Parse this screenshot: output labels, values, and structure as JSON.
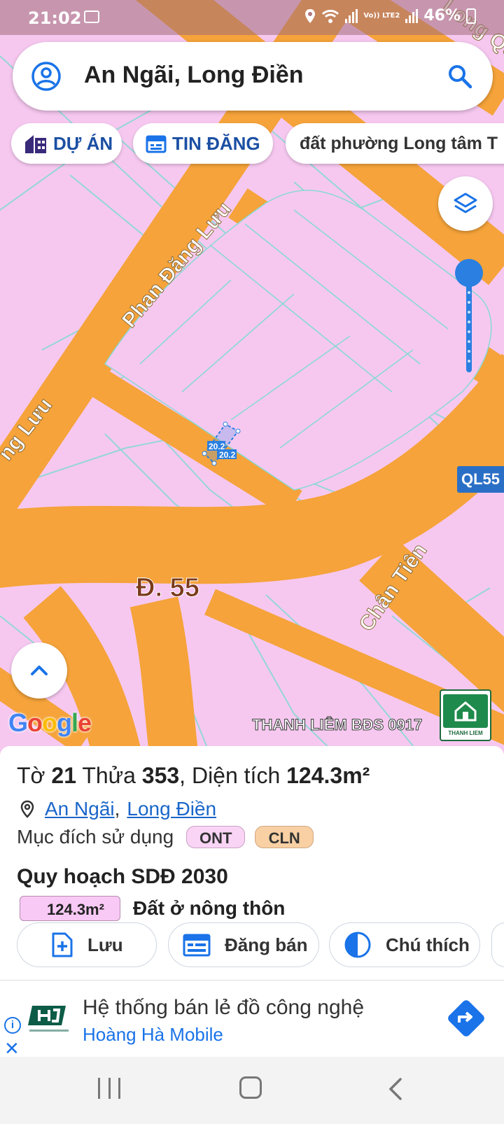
{
  "status_bar": {
    "time": "21:02",
    "battery": "46%",
    "network_label": "Vo)) LTE2"
  },
  "search": {
    "query": "An Ngãi, Long Điền"
  },
  "chips": {
    "project": "DỰ ÁN",
    "listings": "TIN ĐĂNG",
    "suggestion": "đất phường Long tâm T"
  },
  "map": {
    "roads": {
      "phan_dang_luu": "Phan Đăng Lưu",
      "phan_dang_luu_partial": "ng Lưu",
      "duong_55": "Đ. 55",
      "chan_tien": "Chân Tiên",
      "ql55": "QL55",
      "top_right_partial": "Long Quy H"
    },
    "parcel_labels": [
      "20.2",
      "20.2"
    ],
    "google": "Google",
    "watermark": "THANH LIÊM BĐS 0917",
    "logo_text": "THANH LIEM",
    "colors": {
      "residential": "#f6c8f0",
      "road": "#f5a33a",
      "parcel_lines": "#7fd7d2",
      "accent": "#1a73e8"
    }
  },
  "parcel": {
    "title_prefix": "Tờ",
    "sheet_no": "21",
    "parcel_label": "Thửa",
    "parcel_no": "353",
    "area_label": ", Diện tích",
    "area_value": "124.3m²",
    "location_commune": "An Ngãi",
    "location_separator": ",",
    "location_district": "Long Điền",
    "purpose_label": "Mục đích sử dụng",
    "purpose_codes": [
      "ONT",
      "CLN"
    ],
    "plan_title": "Quy hoạch SDĐ 2030",
    "plan_area": "124.3m²",
    "plan_desc": "Đất ở nông thôn"
  },
  "actions": {
    "save": "Lưu",
    "sell": "Đăng bán",
    "legend": "Chú thích"
  },
  "ad": {
    "headline": "Hệ thống bán lẻ đồ công nghệ",
    "advertiser": "Hoàng Hà Mobile",
    "info": "i",
    "close": "✕"
  }
}
